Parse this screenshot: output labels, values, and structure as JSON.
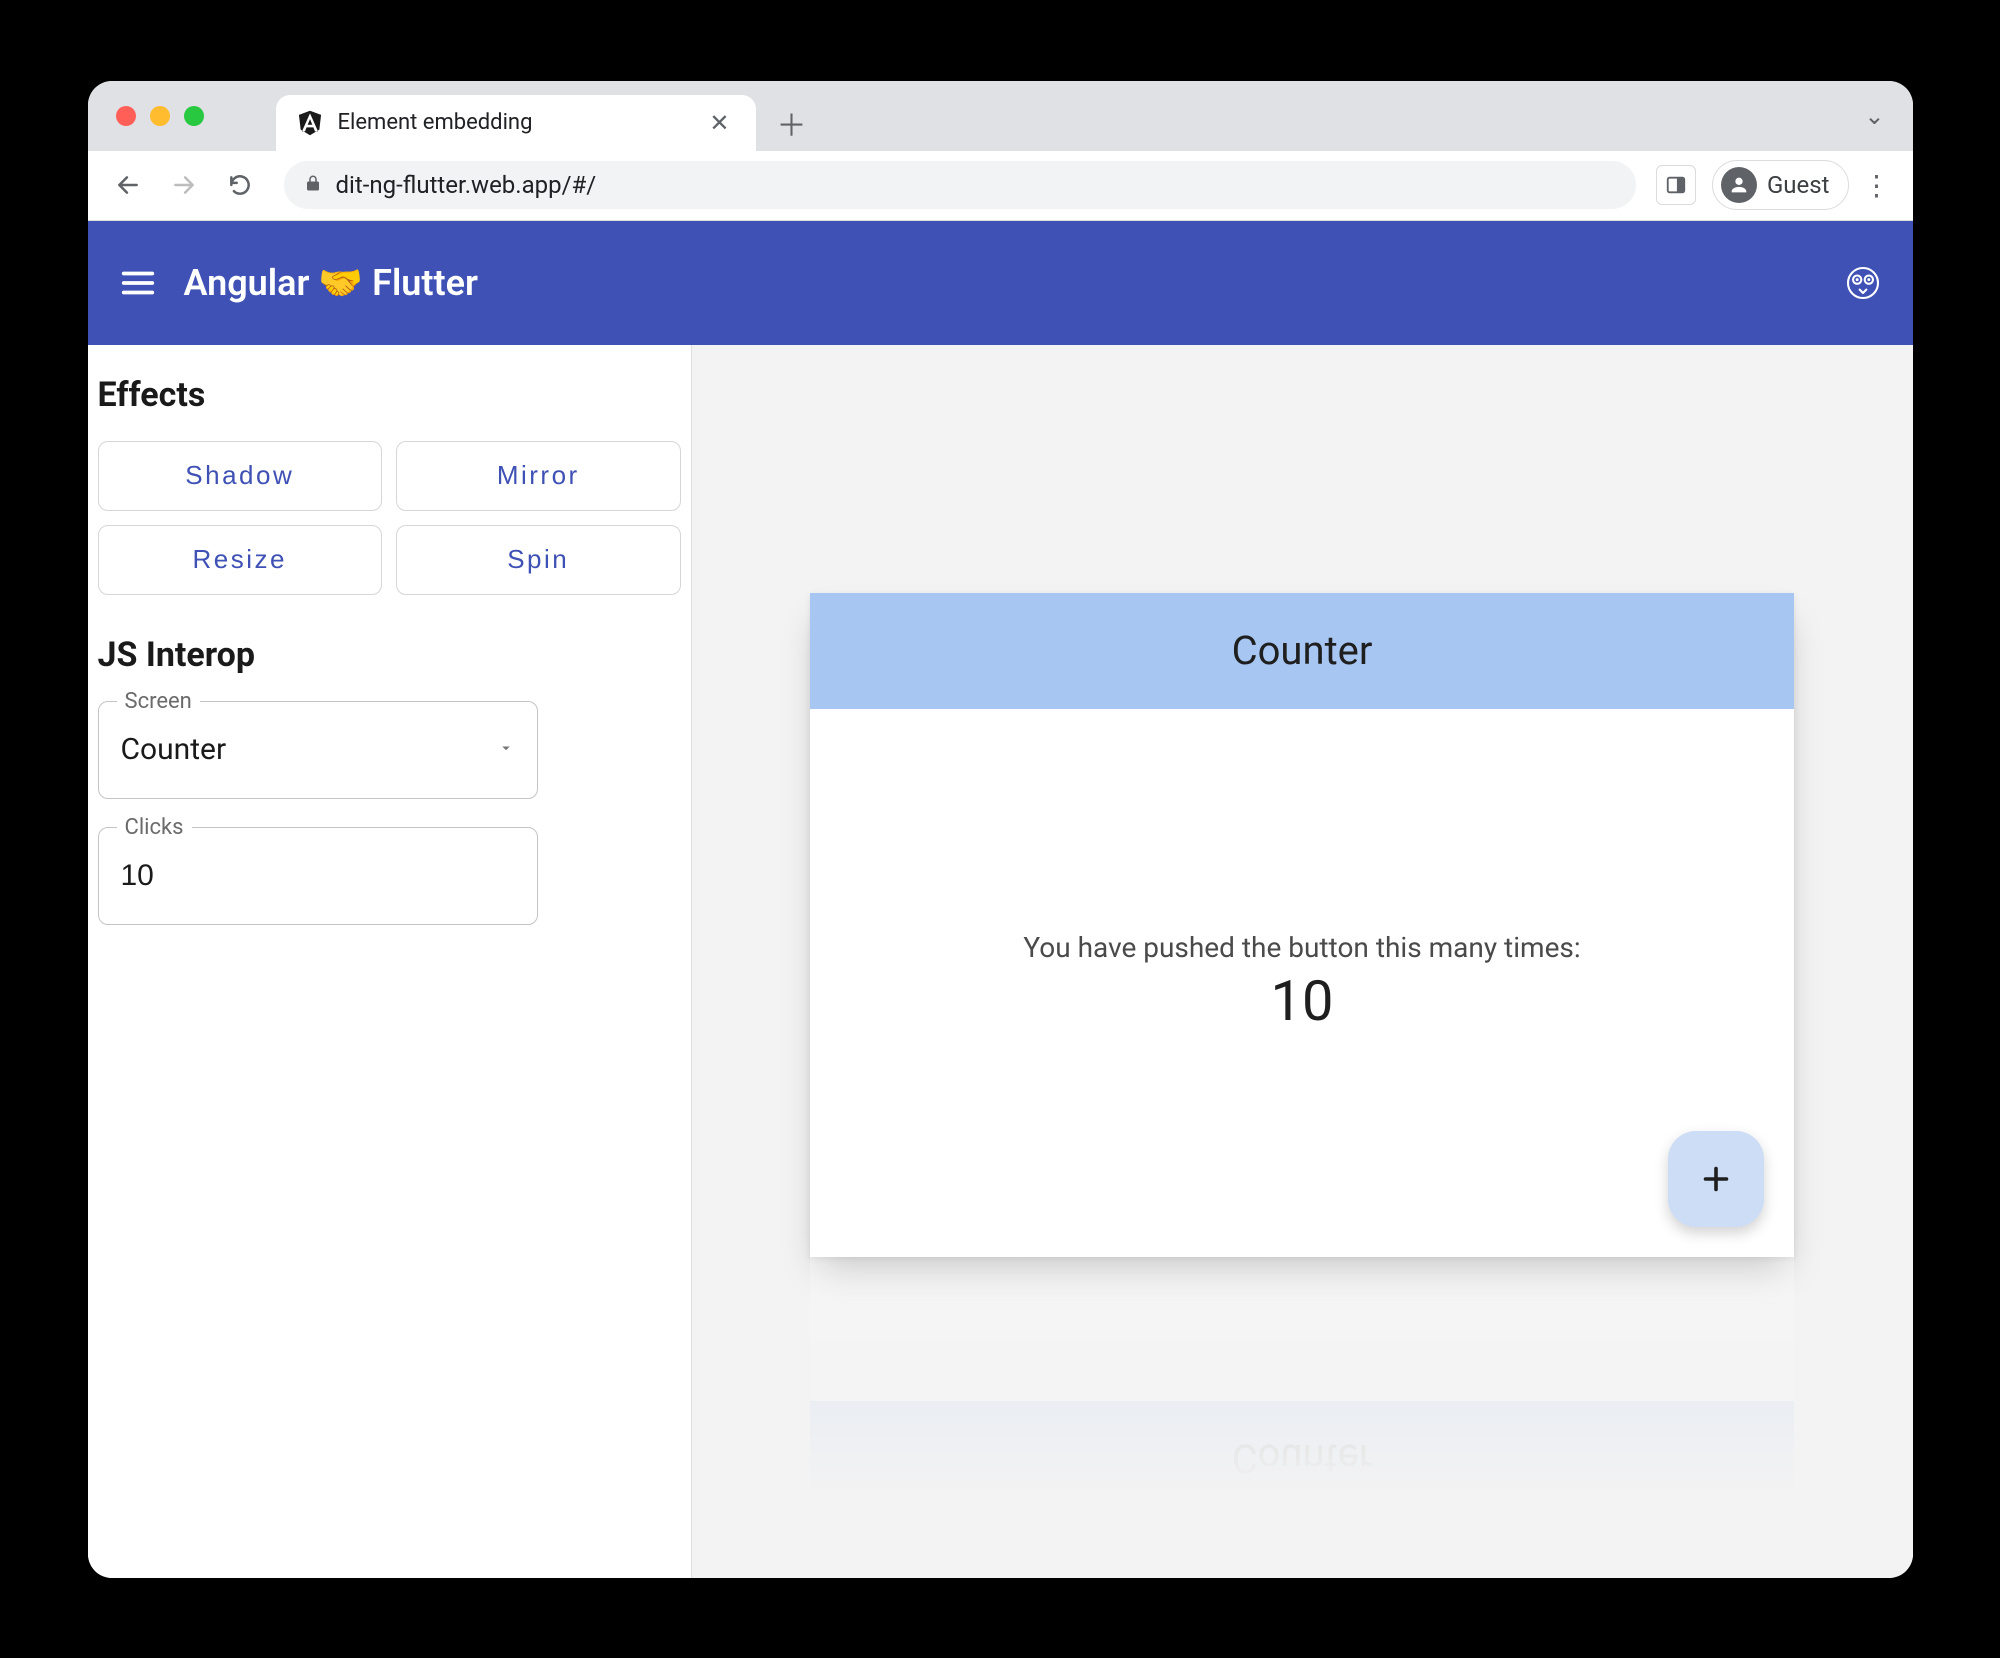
{
  "browser": {
    "tab_title": "Element embedding",
    "url": "dit-ng-flutter.web.app/#/",
    "guest_label": "Guest"
  },
  "appbar": {
    "title_prefix": "Angular",
    "title_emoji": "🤝",
    "title_suffix": "Flutter"
  },
  "sidebar": {
    "effects_heading": "Effects",
    "effects": {
      "shadow": "Shadow",
      "mirror": "Mirror",
      "resize": "Resize",
      "spin": "Spin"
    },
    "interop_heading": "JS Interop",
    "screen_label": "Screen",
    "screen_value": "Counter",
    "clicks_label": "Clicks",
    "clicks_value": "10"
  },
  "counter": {
    "header": "Counter",
    "message": "You have pushed the button this many times:",
    "value": "10"
  }
}
